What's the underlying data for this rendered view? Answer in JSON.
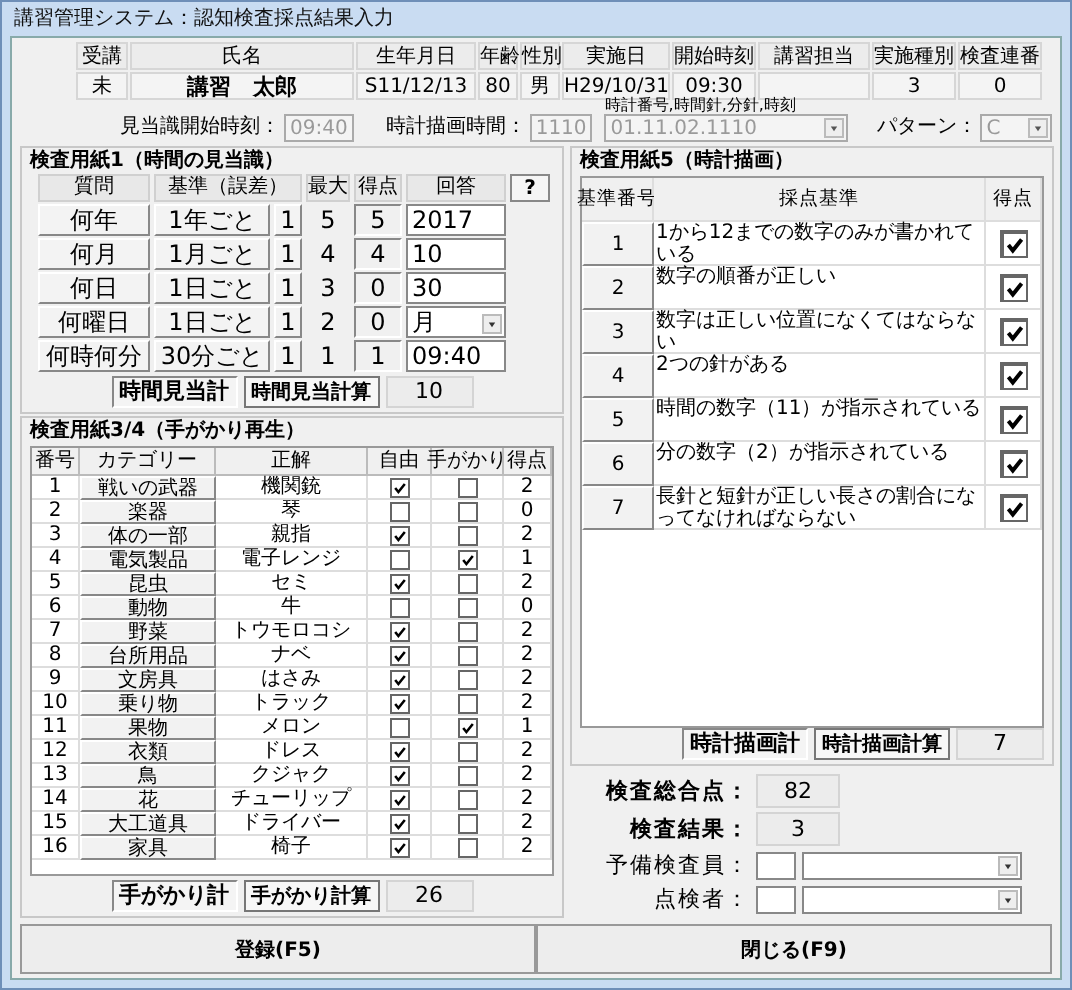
{
  "window": {
    "title": "講習管理システム：認知検査採点結果入力"
  },
  "header": {
    "fields": [
      {
        "label": "受講",
        "value": "未",
        "bold": false
      },
      {
        "label": "氏名",
        "value": "講習　太郎",
        "bold": true
      },
      {
        "label": "生年月日",
        "value": "S11/12/13",
        "bold": false
      },
      {
        "label": "年齢",
        "value": "80",
        "bold": false
      },
      {
        "label": "性別",
        "value": "男",
        "bold": false
      },
      {
        "label": "実施日",
        "value": "H29/10/31",
        "bold": false
      },
      {
        "label": "開始時刻",
        "value": "09:30",
        "bold": false
      },
      {
        "label": "講習担当"
      },
      {
        "label": "実施種別",
        "value": "3",
        "bold": false
      },
      {
        "label": "検査連番",
        "value": "0",
        "bold": false
      }
    ]
  },
  "timing": {
    "orientation_start": {
      "label": "見当識開始時刻：",
      "value": "09:40",
      "disabled": true
    },
    "clock_time": {
      "label": "時計描画時間：",
      "value": "1110",
      "disabled": true
    },
    "clock_code": {
      "caption": "時計番号,時間針,分針,時刻",
      "value": "01.11.02.1110",
      "disabled": true
    },
    "pattern": {
      "label": "パターン：",
      "value": "C",
      "disabled": true
    }
  },
  "orientation": {
    "title": "検査用紙1（時間の見当識）",
    "columns": [
      "質問",
      "基準（誤差）",
      "最大",
      "得点",
      "回答"
    ],
    "help_button": "?",
    "rows": [
      {
        "question": "何年",
        "base": "1年ごと",
        "error": "1",
        "max": "5",
        "score": "5",
        "answer": "2017",
        "kind": "text"
      },
      {
        "question": "何月",
        "base": "1月ごと",
        "error": "1",
        "max": "4",
        "score": "4",
        "answer": "10",
        "kind": "text"
      },
      {
        "question": "何日",
        "base": "1日ごと",
        "error": "1",
        "max": "3",
        "score": "0",
        "answer": "30",
        "kind": "text"
      },
      {
        "question": "何曜日",
        "base": "1日ごと",
        "error": "1",
        "max": "2",
        "score": "0",
        "answer": "月",
        "kind": "dropdown"
      },
      {
        "question": "何時何分",
        "base": "30分ごと",
        "error": "1",
        "max": "1",
        "score": "1",
        "answer": "09:40",
        "kind": "text"
      }
    ],
    "total_label": "時間見当計",
    "calc_button": "時間見当計算",
    "total": "10"
  },
  "recall": {
    "title": "検査用紙3/4（手がかり再生）",
    "columns": [
      "番号",
      "カテゴリー",
      "正解",
      "自由",
      "手がかり",
      "得点"
    ],
    "rows": [
      {
        "no": "1",
        "category": "戦いの武器",
        "answer": "機関銃",
        "free": true,
        "cued": false,
        "score": "2"
      },
      {
        "no": "2",
        "category": "楽器",
        "answer": "琴",
        "free": false,
        "cued": false,
        "score": "0"
      },
      {
        "no": "3",
        "category": "体の一部",
        "answer": "親指",
        "free": true,
        "cued": false,
        "score": "2"
      },
      {
        "no": "4",
        "category": "電気製品",
        "answer": "電子レンジ",
        "free": false,
        "cued": true,
        "score": "1"
      },
      {
        "no": "5",
        "category": "昆虫",
        "answer": "セミ",
        "free": true,
        "cued": false,
        "score": "2"
      },
      {
        "no": "6",
        "category": "動物",
        "answer": "牛",
        "free": false,
        "cued": false,
        "score": "0"
      },
      {
        "no": "7",
        "category": "野菜",
        "answer": "トウモロコシ",
        "free": true,
        "cued": false,
        "score": "2"
      },
      {
        "no": "8",
        "category": "台所用品",
        "answer": "ナベ",
        "free": true,
        "cued": false,
        "score": "2"
      },
      {
        "no": "9",
        "category": "文房具",
        "answer": "はさみ",
        "free": true,
        "cued": false,
        "score": "2"
      },
      {
        "no": "10",
        "category": "乗り物",
        "answer": "トラック",
        "free": true,
        "cued": false,
        "score": "2"
      },
      {
        "no": "11",
        "category": "果物",
        "answer": "メロン",
        "free": false,
        "cued": true,
        "score": "1"
      },
      {
        "no": "12",
        "category": "衣類",
        "answer": "ドレス",
        "free": true,
        "cued": false,
        "score": "2"
      },
      {
        "no": "13",
        "category": "鳥",
        "answer": "クジャク",
        "free": true,
        "cued": false,
        "score": "2"
      },
      {
        "no": "14",
        "category": "花",
        "answer": "チューリップ",
        "free": true,
        "cued": false,
        "score": "2"
      },
      {
        "no": "15",
        "category": "大工道具",
        "answer": "ドライバー",
        "free": true,
        "cued": false,
        "score": "2"
      },
      {
        "no": "16",
        "category": "家具",
        "answer": "椅子",
        "free": true,
        "cued": false,
        "score": "2"
      }
    ],
    "total_label": "手がかり計",
    "calc_button": "手がかり計算",
    "total": "26"
  },
  "clock": {
    "title": "検査用紙5（時計描画）",
    "columns": [
      "基準番号",
      "採点基準",
      "得点"
    ],
    "rows": [
      {
        "no": "1",
        "criterion": "1から12までの数字のみが書かれている",
        "checked": true
      },
      {
        "no": "2",
        "criterion": "数字の順番が正しい",
        "checked": true
      },
      {
        "no": "3",
        "criterion": "数字は正しい位置になくてはならない",
        "checked": true
      },
      {
        "no": "4",
        "criterion": "2つの針がある",
        "checked": true
      },
      {
        "no": "5",
        "criterion": "時間の数字（11）が指示されている",
        "checked": true
      },
      {
        "no": "6",
        "criterion": "分の数字（2）が指示されている",
        "checked": true
      },
      {
        "no": "7",
        "criterion": "長針と短針が正しい長さの割合になってなければならない",
        "checked": true
      }
    ],
    "total_label": "時計描画計",
    "calc_button": "時計描画計算",
    "total": "7"
  },
  "summary": {
    "total_score": {
      "label": "検査総合点：",
      "value": "82"
    },
    "result": {
      "label": "検査結果：",
      "value": "3"
    },
    "preliminary_examiner": {
      "label": "予備検査員："
    },
    "checker": {
      "label": "点検者："
    }
  },
  "buttons": [
    {
      "label": "登録(F5)"
    },
    {
      "label": "閉じる(F9)"
    }
  ]
}
